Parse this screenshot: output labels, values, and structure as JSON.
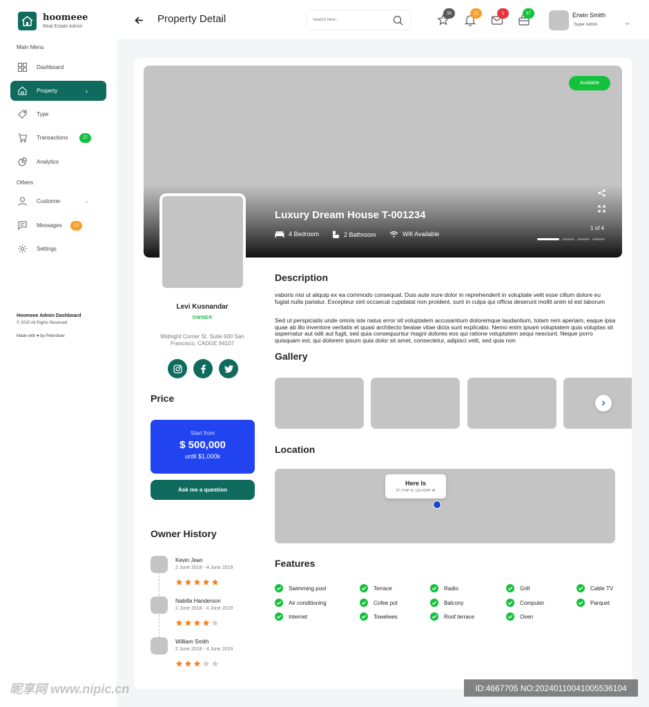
{
  "brand": {
    "name": "hoomeee",
    "subtitle": "Real Estate Admin"
  },
  "sidebar": {
    "main_menu_label": "Main Menu",
    "others_label": "Others",
    "items": [
      {
        "label": "Dashboard",
        "icon": "grid-icon"
      },
      {
        "label": "Property",
        "icon": "home-icon",
        "active": true
      },
      {
        "label": "Type",
        "icon": "tag-icon"
      },
      {
        "label": "Transactions",
        "icon": "cart-icon",
        "badge": "27"
      },
      {
        "label": "Analytics",
        "icon": "pie-chart-icon"
      },
      {
        "label": "Customer",
        "icon": "user-icon"
      },
      {
        "label": "Messages",
        "icon": "message-icon",
        "badge": "12"
      },
      {
        "label": "Settings",
        "icon": "gear-icon"
      }
    ],
    "footer": {
      "title": "Hoomeee Admin Dashboard",
      "copyright": "© 2020 All Rights Reserved",
      "made_with": "Made with ♥ by Peterdraw"
    }
  },
  "header": {
    "title": "Property Detail",
    "search_placeholder": "Search here...",
    "badges": {
      "favorites": "38",
      "notifications": "12",
      "mail": "1",
      "bag": "67"
    },
    "user": {
      "name": "Erwin Smith",
      "role": "Super Admin"
    }
  },
  "property": {
    "status": "Available",
    "title": "Luxury Dream House T-001234",
    "bedrooms": "4 Bedroom",
    "bathrooms": "2 Bathroom",
    "wifi": "Wifi Available",
    "photo_counter": "1 of 4"
  },
  "owner": {
    "name": "Levi Kusnandar",
    "role": "OWNER",
    "address": "Midnight Corner St. Suite 600 San Francisco, CADGE 94107"
  },
  "price": {
    "section_title": "Price",
    "from_label": "Start from",
    "value": "$ 500,000",
    "until": "until $1,000k",
    "ask_button": "Ask me a question"
  },
  "history": {
    "section_title": "Owner History",
    "entries": [
      {
        "name": "Kevin Jean",
        "dates": "2 June 2018 - 4 June 2019",
        "rating": 5
      },
      {
        "name": "Nabilla Handerson",
        "dates": "2 June 2018 - 4 June 2019",
        "rating": 4
      },
      {
        "name": "William Smith",
        "dates": "2 June 2018 - 4 June 2019",
        "rating": 3
      }
    ]
  },
  "description": {
    "section_title": "Description",
    "para1": "vaboris nisi ut aliquip ex ea commodo consequat. Duis aute irure dolor in reprehenderit in voluptate velit esse cillum dolore eu fugiat nulla pariatur. Excepteur sint occaecat cupidatat non proident, sunt in culpa qui officia deserunt mollit anim id est laborum",
    "para2": "Sed ut perspiciatis unde omnis iste natus error sit voluptatem accusantium doloremque laudantium, totam rem aperiam, eaque ipsa quae ab illo inventore veritatis et quasi architecto beatae vitae dicta sunt explicabo. Nemo enim ipsam voluptatem quia voluptas sit aspernatur aut odit aut fugit, sed quia consequuntur magni dolores eos qui ratione voluptatem sequi nesciunt. Neque porro quisquam est, qui dolorem ipsum quia dolor sit amet, consectetur, adipisci velit, sed quia non"
  },
  "gallery": {
    "section_title": "Gallery"
  },
  "location": {
    "section_title": "Location",
    "tooltip_title": "Here Is",
    "coords": "37.7749° N, 122.4194° W"
  },
  "features": {
    "section_title": "Features",
    "items": [
      "Swimming pool",
      "Terrace",
      "Radio",
      "Grill",
      "Cable TV",
      "Air conditioning",
      "Cofee pot",
      "Balcony",
      "Computer",
      "Parquet",
      "Internet",
      "Towelwes",
      "Roof terrace",
      "Oven"
    ]
  },
  "watermark": {
    "left": "昵享网 www.nipic.cn",
    "right": "ID:4667705 NO:20240110041005536104"
  },
  "colors": {
    "primary": "#0f6b5e",
    "price_blue": "#2144f0",
    "green": "#12c13c",
    "orange_star": "#f5811f",
    "badge_gray": "#5a5a5a",
    "badge_orange": "#f6a02c",
    "badge_red": "#e8323c",
    "badge_green": "#12c13c"
  }
}
